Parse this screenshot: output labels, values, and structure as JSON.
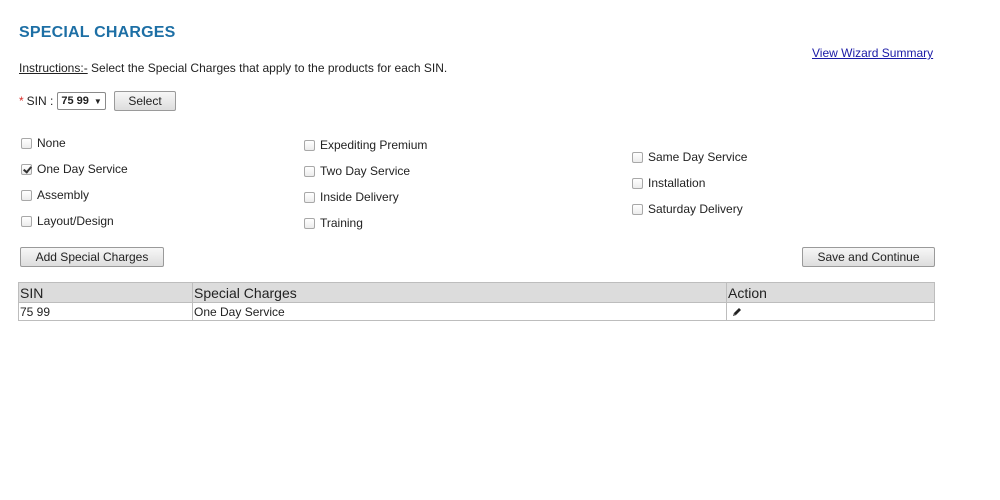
{
  "header": {
    "title": "SPECIAL CHARGES",
    "wizard_link": "View Wizard Summary"
  },
  "instructions": {
    "label": "Instructions:-",
    "text": " Select the Special Charges that apply to the products for each SIN."
  },
  "sin": {
    "required_mark": "*",
    "label": "SIN :",
    "selected": "75 99",
    "select_button": "Select"
  },
  "charges": [
    {
      "label": "None",
      "checked": false
    },
    {
      "label": "One Day Service",
      "checked": true
    },
    {
      "label": "Assembly",
      "checked": false
    },
    {
      "label": "Layout/Design",
      "checked": false
    },
    {
      "label": "Expediting Premium",
      "checked": false
    },
    {
      "label": "Two Day Service",
      "checked": false
    },
    {
      "label": "Inside Delivery",
      "checked": false
    },
    {
      "label": "Training",
      "checked": false
    },
    {
      "label": "Same Day Service",
      "checked": false
    },
    {
      "label": "Installation",
      "checked": false
    },
    {
      "label": "Saturday Delivery",
      "checked": false
    }
  ],
  "buttons": {
    "add": "Add Special Charges",
    "save": "Save and Continue"
  },
  "table": {
    "headers": [
      "SIN",
      "Special Charges",
      "Action"
    ],
    "rows": [
      {
        "sin": "75 99",
        "charges": "One Day Service",
        "action_icon": "pencil-icon"
      }
    ]
  },
  "colors": {
    "title": "#1d6fa5",
    "link": "#1a1aa6",
    "required": "#d9302c",
    "table_header": "#dcdcdc"
  }
}
